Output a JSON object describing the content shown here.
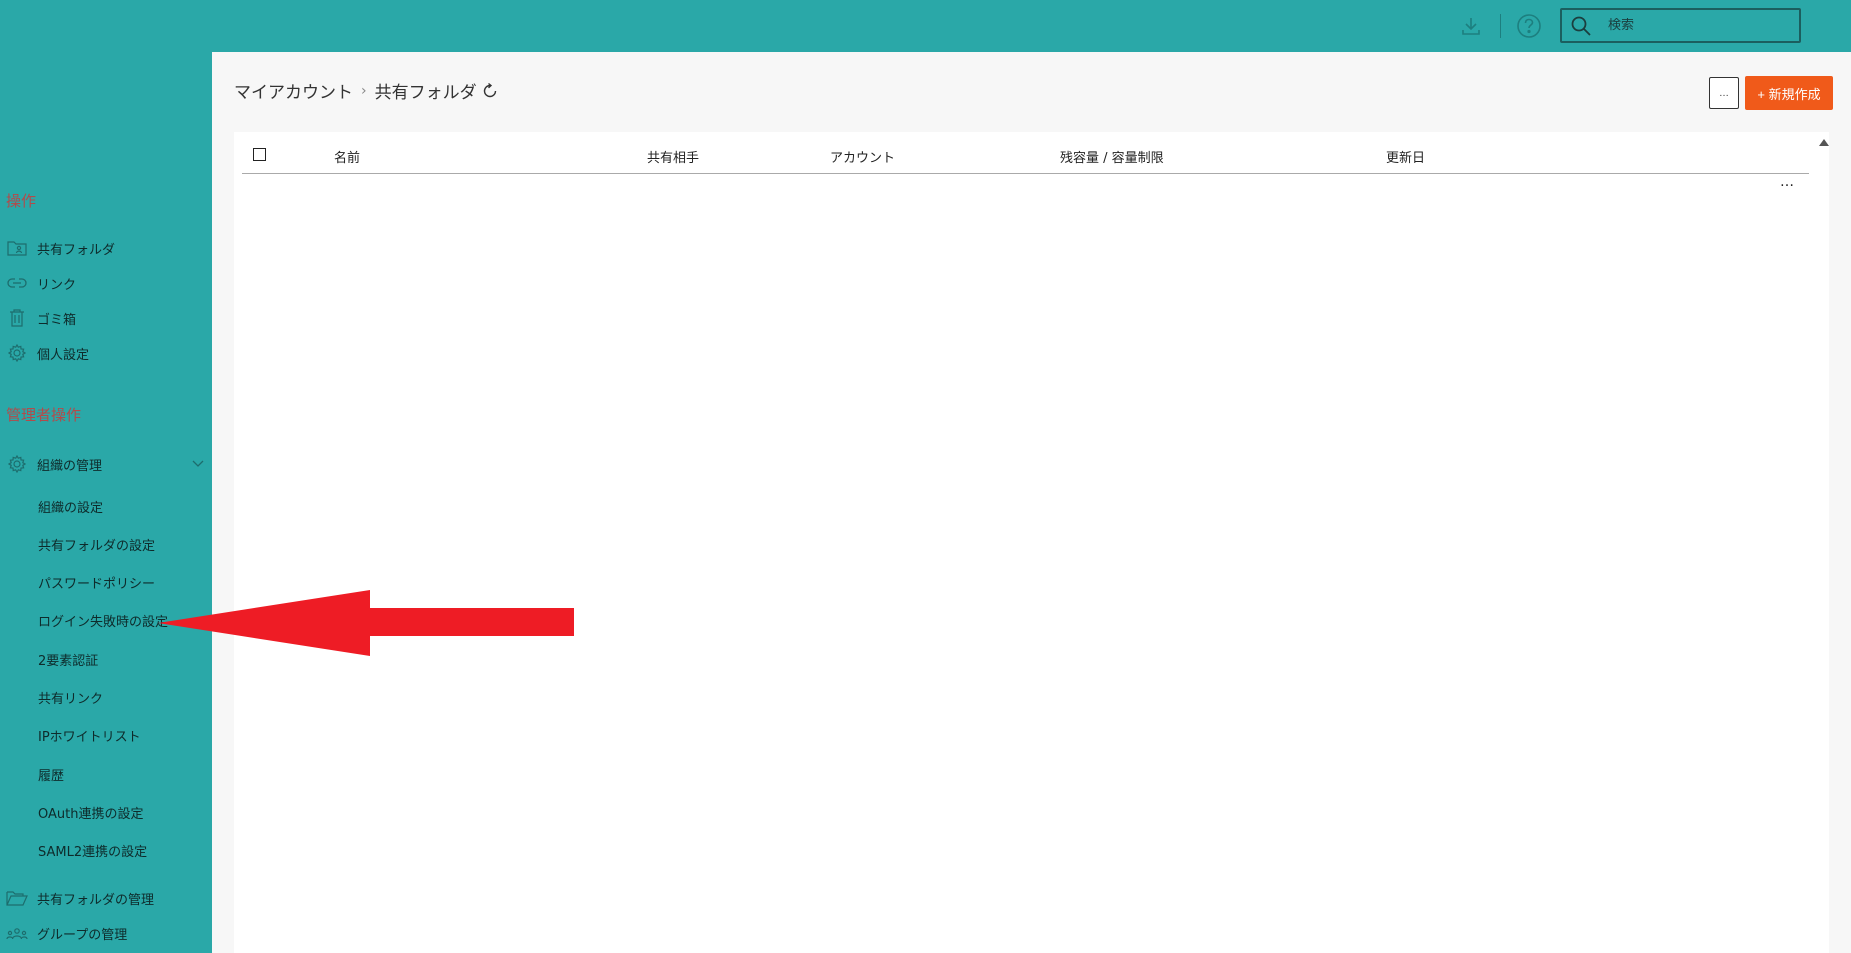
{
  "topbar": {
    "search_placeholder": "検索",
    "download_icon": "download-icon",
    "help_icon": "help-icon",
    "search_icon": "search-icon"
  },
  "sidebar": {
    "section_ops": "操作",
    "ops_items": [
      {
        "label": "共有フォルダ",
        "icon": "shared-folder-icon"
      },
      {
        "label": "リンク",
        "icon": "link-icon"
      },
      {
        "label": "ゴミ箱",
        "icon": "trash-icon"
      },
      {
        "label": "個人設定",
        "icon": "gear-icon"
      }
    ],
    "section_admin": "管理者操作",
    "org_manage": {
      "label": "組織の管理",
      "icon": "gear-icon"
    },
    "org_sub_items": [
      "組織の設定",
      "共有フォルダの設定",
      "パスワードポリシー",
      "ログイン失敗時の設定",
      "2要素認証",
      "共有リンク",
      "IPホワイトリスト",
      "履歴",
      "OAuth連携の設定",
      "SAML2連携の設定"
    ],
    "shared_folder_manage": {
      "label": "共有フォルダの管理",
      "icon": "folder-open-icon"
    },
    "group_manage": {
      "label": "グループの管理",
      "icon": "group-icon"
    }
  },
  "main": {
    "breadcrumb": {
      "root": "マイアカウント",
      "current": "共有フォルダ"
    },
    "more_button": "…",
    "new_button": "+ 新規作成",
    "table": {
      "columns": [
        "名前",
        "共有相手",
        "アカウント",
        "残容量 / 容量制限",
        "更新日"
      ],
      "row_more": "…"
    }
  },
  "colors": {
    "teal": "#2aa8a8",
    "accent_orange": "#f05a1a",
    "section_red": "#b24b4b",
    "annotation_arrow": "#ee1c25"
  }
}
